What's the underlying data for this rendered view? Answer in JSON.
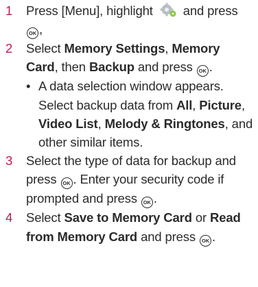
{
  "ok_key_label": "OK",
  "steps": [
    {
      "num": "1",
      "t1": "Press [Menu], highlight",
      "t2": "and press",
      "t3": ","
    },
    {
      "num": "2",
      "t1": "Select",
      "b1": "Memory Settings",
      "t2": ",",
      "b2": "Memory Card",
      "t3": ", then",
      "b3": "Backup",
      "t4": "and press",
      "t5": ".",
      "bullet": {
        "t1": "A data selection window appears. Select backup data from",
        "b1": "All",
        "t2": ",",
        "b2": "Picture",
        "t3": ",",
        "b3": "Video List",
        "t4": ",",
        "b4": "Melody & Ringtones",
        "t5": ", and other similar items."
      }
    },
    {
      "num": "3",
      "t1": "Select the type of data for backup and press",
      "t2": ". Enter your security code if prompted and press",
      "t3": "."
    },
    {
      "num": "4",
      "t1": "Select",
      "b1": "Save to Memory Card",
      "t2": "or",
      "b2": "Read from Memory Card",
      "t3": "and press",
      "t4": "."
    }
  ]
}
